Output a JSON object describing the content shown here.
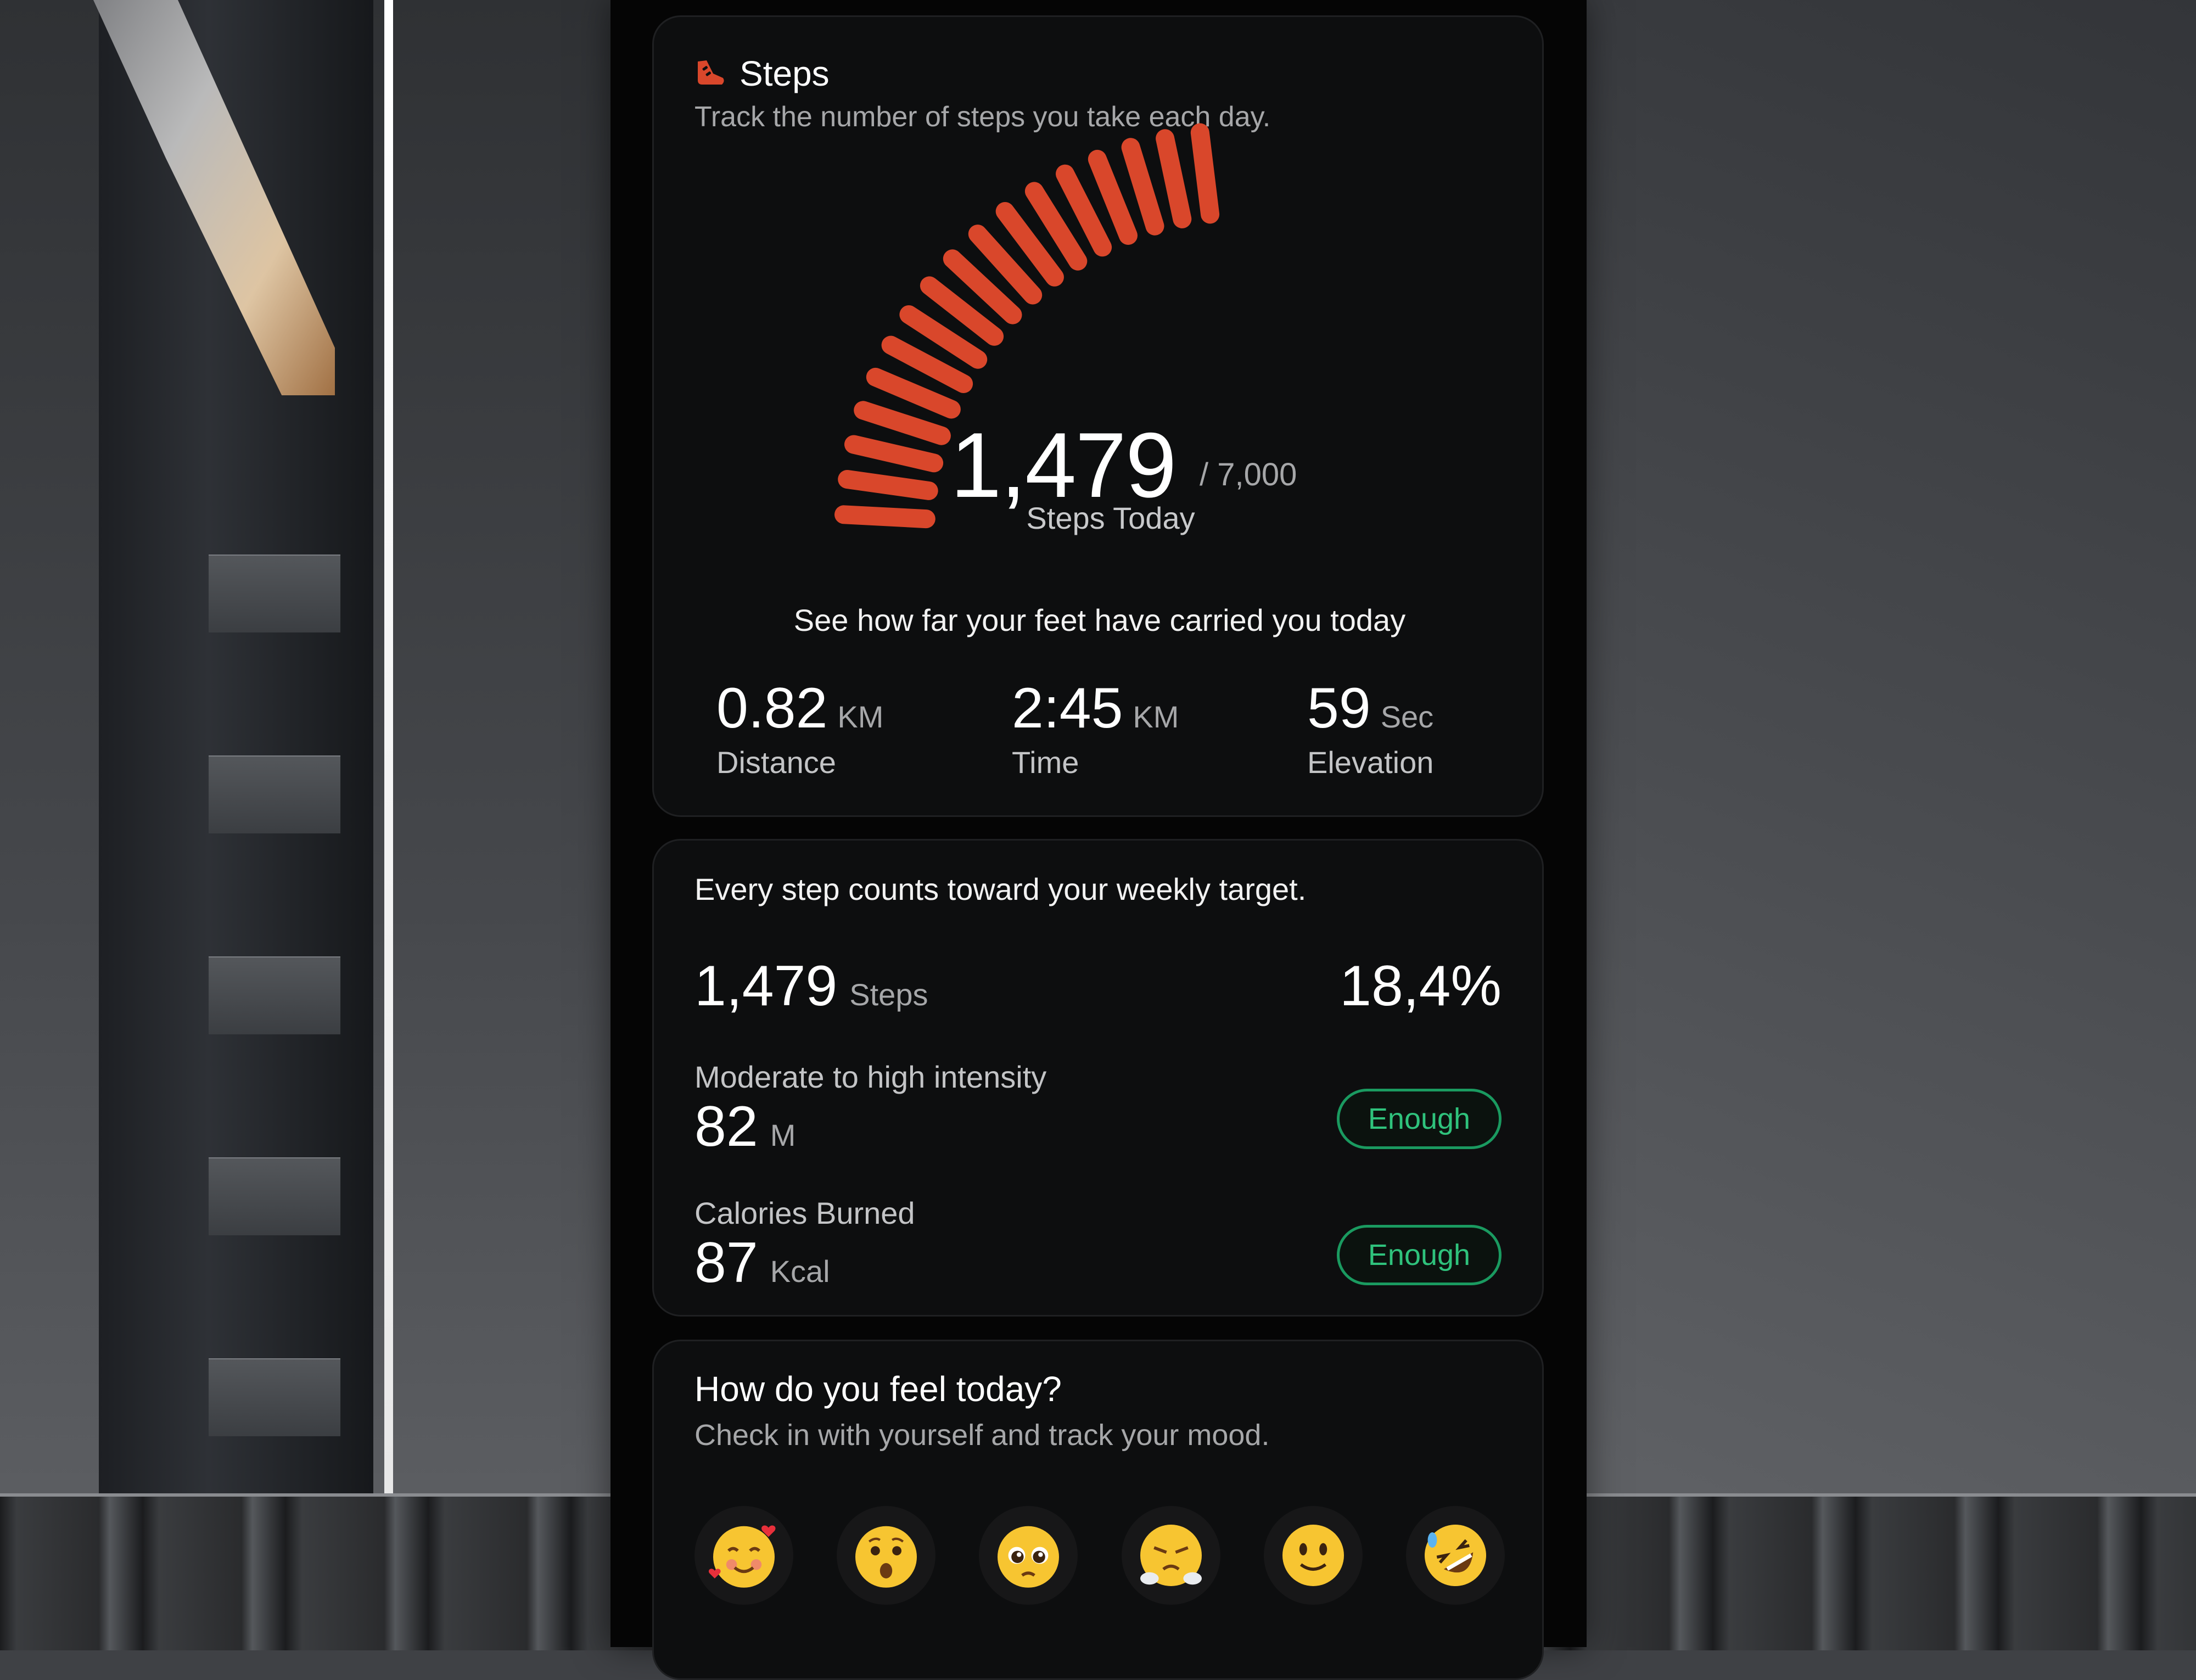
{
  "steps_card": {
    "title": "Steps",
    "subtitle": "Track the number of steps you take each day.",
    "steps_value": "1,479",
    "steps_goal": "/ 7,000",
    "steps_label": "Steps Today",
    "gauge_progress": 0.211,
    "feet_text": "See how far your feet have carried you today",
    "stats": [
      {
        "value": "0.82",
        "unit": "KM",
        "label": "Distance"
      },
      {
        "value": "2:45",
        "unit": "KM",
        "label": "Time"
      },
      {
        "value": "59",
        "unit": "Sec",
        "label": "Elevation"
      }
    ]
  },
  "weekly_card": {
    "intro": "Every step counts toward your weekly target.",
    "steps_value": "1,479",
    "steps_unit": "Steps",
    "percent": "18,4%",
    "intensity": {
      "label": "Moderate to high intensity",
      "value": "82",
      "unit": "M",
      "status": "Enough"
    },
    "calories": {
      "label": "Calories Burned",
      "value": "87",
      "unit": "Kcal",
      "status": "Enough"
    }
  },
  "mood_card": {
    "title": "How do you feel today?",
    "subtitle": "Check in with yourself and track your mood.",
    "moods": [
      "smiling-face-with-hearts-icon",
      "astonished-face-icon",
      "pleading-face-icon",
      "face-with-steam-icon",
      "slightly-smiling-face-icon",
      "rolling-on-floor-laughing-icon"
    ]
  },
  "colors": {
    "accent": "#d9472b",
    "success": "#2fc27c",
    "card_bg": "#0d0e0f"
  }
}
